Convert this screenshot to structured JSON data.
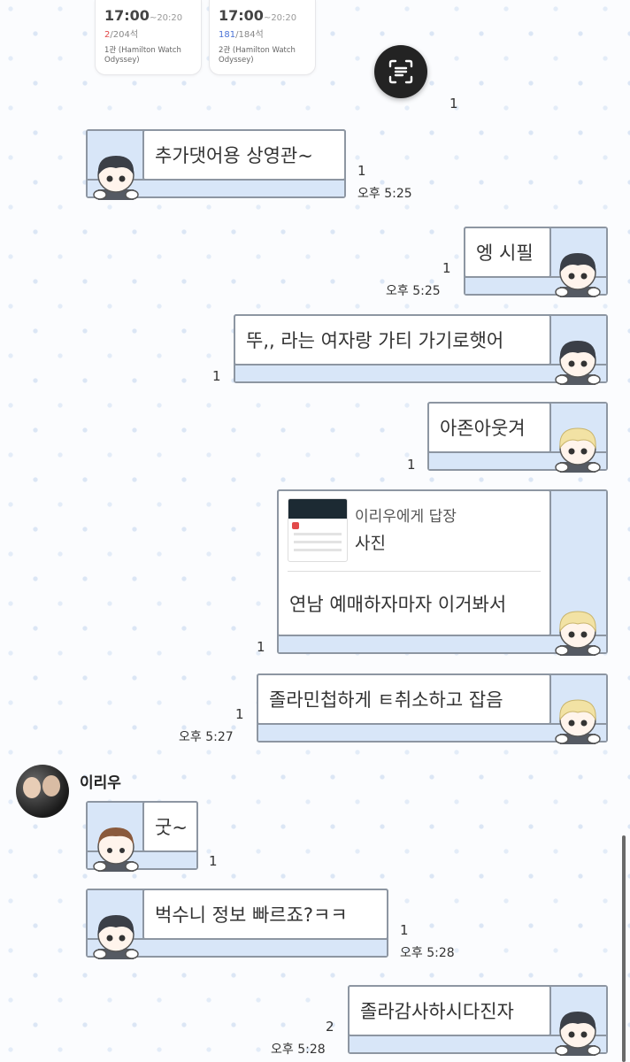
{
  "tickets": [
    {
      "time": "17:00",
      "end": "~20:20",
      "seats_taken": "2",
      "seats_total": "/204석",
      "hall": "1관 (Hamilton Watch Odyssey)"
    },
    {
      "time": "17:00",
      "end": "~20:20",
      "seats_taken": "181",
      "seats_total": "/184석",
      "hall": "2관 (Hamilton Watch Odyssey)"
    }
  ],
  "unread_top": "1",
  "messages": [
    {
      "text": "추가댓어용 상영관~",
      "read": "1",
      "time": "오후 5:25"
    },
    {
      "text": "엥 시필",
      "read": "1",
      "time": "오후 5:25"
    },
    {
      "text": "뚜,, 라는 여자랑 가티 가기로햇어",
      "read": "1"
    },
    {
      "text": "아존아웃겨",
      "read": "1"
    },
    {
      "reply_to": "이리우에게 답장",
      "reply_kind": "사진",
      "text": "연남 예매하자마자 이거봐서",
      "read": "1"
    },
    {
      "text": "졸라민첩하게 ㅌ취소하고 잡음",
      "read": "1",
      "time": "오후 5:27"
    },
    {
      "text": "굿~",
      "read": "1"
    },
    {
      "text": "벅수니 정보 빠르죠?ㅋㅋ",
      "read": "1",
      "time": "오후 5:28"
    },
    {
      "text": "졸라감사하시다진자",
      "read": "2",
      "time": "오후 5:28"
    }
  ],
  "sender_name": "이리우",
  "icons": [
    "scan-text-icon",
    "character-avatar-icon",
    "profile-photo"
  ]
}
